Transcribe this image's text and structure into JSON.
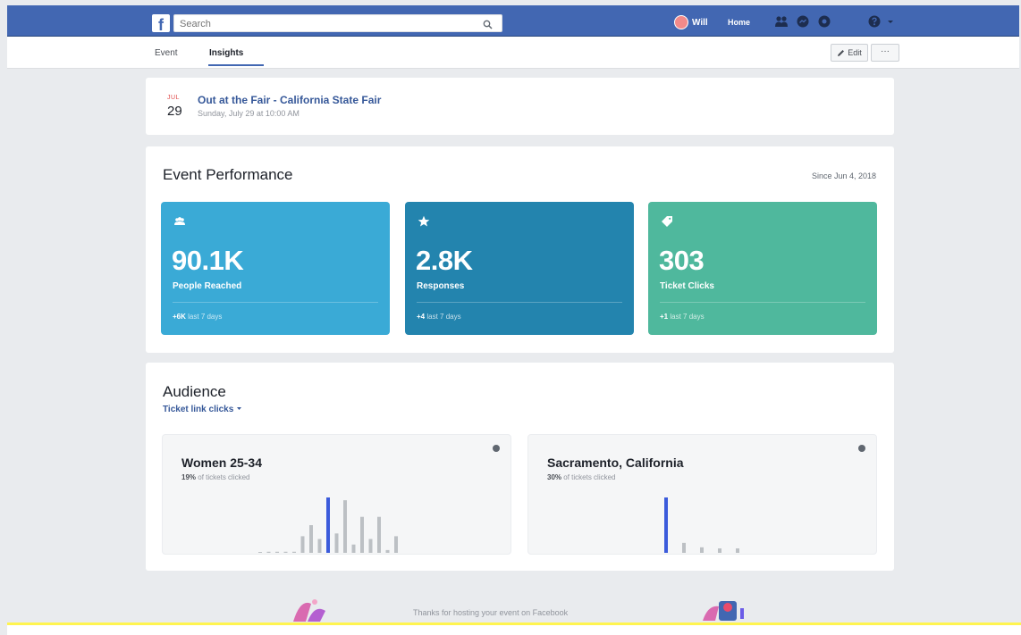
{
  "topbar": {
    "logo": "f",
    "search_placeholder": "Search",
    "profile_name": "Will",
    "home_label": "Home",
    "icons": [
      "friends-icon",
      "messenger-icon",
      "notifications-icon"
    ]
  },
  "subnav": {
    "tabs": [
      {
        "label": "Event"
      },
      {
        "label": "Insights",
        "active": true
      }
    ],
    "edit_label": "Edit",
    "more_label": "···"
  },
  "event": {
    "month": "JUL",
    "day": "29",
    "title": "Out at the Fair - California State Fair",
    "datetime": "Sunday, July 29 at 10:00 AM"
  },
  "performance": {
    "title": "Event Performance",
    "since": "Since Jun 4, 2018",
    "metrics": [
      {
        "icon": "people-icon",
        "value": "90.1K",
        "label": "People Reached",
        "change": "+6K",
        "period": "last 7 days",
        "color": "#3aaad6"
      },
      {
        "icon": "star-icon",
        "value": "2.8K",
        "label": "Responses",
        "change": "+4",
        "period": "last 7 days",
        "color": "#2384ae"
      },
      {
        "icon": "ticket-icon",
        "value": "303",
        "label": "Ticket Clicks",
        "change": "+1",
        "period": "last 7 days",
        "color": "#4fb89d"
      }
    ]
  },
  "audience": {
    "title": "Audience",
    "filter": "Ticket link clicks",
    "panels": [
      {
        "title": "Women 25-34",
        "pct": "19%",
        "sub": "of tickets clicked",
        "bars": [
          0,
          0.02,
          0.02,
          0.02,
          0.02,
          0.3,
          0.5,
          0.25,
          1.0,
          0.35,
          0.95,
          0.15,
          0.65,
          0.25,
          0.65,
          0.05,
          0.3
        ],
        "highlight_index": 8
      },
      {
        "title": "Sacramento, California",
        "pct": "30%",
        "sub": "of tickets clicked",
        "bars": [
          1.0,
          0.18,
          0.1,
          0.08,
          0.08
        ],
        "highlight_index": 0
      }
    ]
  },
  "footer": {
    "thanks": "Thanks for hosting your event on Facebook"
  },
  "colors": {
    "brand": "#4267b2",
    "link": "#365899",
    "bar_highlight": "#3b5bdb",
    "bar_default": "#bcc0c4"
  }
}
